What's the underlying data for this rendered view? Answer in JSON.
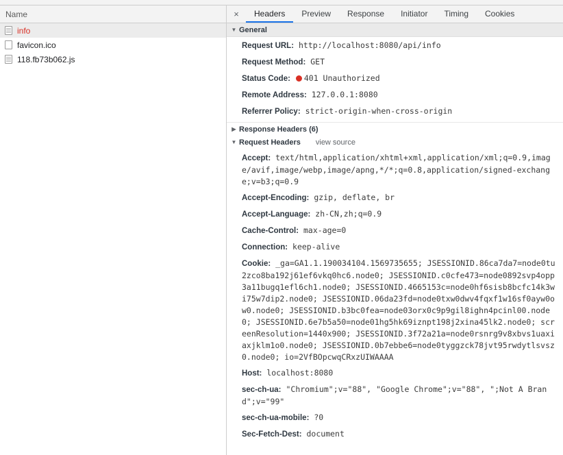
{
  "request_list": {
    "column_header": "Name",
    "rows": [
      {
        "label": "info",
        "icon": "document-icon",
        "selected": true,
        "error": true
      },
      {
        "label": "favicon.ico",
        "icon": "blank-file-icon",
        "selected": false,
        "error": false
      },
      {
        "label": "118.fb73b062.js",
        "icon": "script-icon",
        "selected": false,
        "error": false
      }
    ]
  },
  "details": {
    "close_label": "×",
    "tabs": [
      {
        "label": "Headers",
        "active": true
      },
      {
        "label": "Preview",
        "active": false
      },
      {
        "label": "Response",
        "active": false
      },
      {
        "label": "Initiator",
        "active": false
      },
      {
        "label": "Timing",
        "active": false
      },
      {
        "label": "Cookies",
        "active": false
      }
    ],
    "sections": {
      "general": {
        "title": "General",
        "triangle": "▼",
        "expanded": true,
        "rows": [
          {
            "key": "Request URL:",
            "value": "http://localhost:8080/api/info"
          },
          {
            "key": "Request Method:",
            "value": "GET"
          },
          {
            "key": "Status Code:",
            "value": "401 Unauthorized",
            "status_dot": true
          },
          {
            "key": "Remote Address:",
            "value": "127.0.0.1:8080"
          },
          {
            "key": "Referrer Policy:",
            "value": "strict-origin-when-cross-origin"
          }
        ]
      },
      "response_headers": {
        "title": "Response Headers (6)",
        "triangle": "▶",
        "expanded": false
      },
      "request_headers": {
        "title": "Request Headers",
        "triangle": "▼",
        "view_source": "view source",
        "expanded": true,
        "rows": [
          {
            "key": "Accept:",
            "value": "text/html,application/xhtml+xml,application/xml;q=0.9,image/avif,image/webp,image/apng,*/*;q=0.8,application/signed-exchange;v=b3;q=0.9"
          },
          {
            "key": "Accept-Encoding:",
            "value": "gzip, deflate, br"
          },
          {
            "key": "Accept-Language:",
            "value": "zh-CN,zh;q=0.9"
          },
          {
            "key": "Cache-Control:",
            "value": "max-age=0"
          },
          {
            "key": "Connection:",
            "value": "keep-alive"
          },
          {
            "key": "Cookie:",
            "value": "_ga=GA1.1.190034104.1569735655; JSESSIONID.86ca7da7=node0tu2zco8ba192j61ef6vkq0hc6.node0; JSESSIONID.c0cfe473=node0892svp4opp3a11bugq1efl6ch1.node0; JSESSIONID.4665153c=node0hf6sisb8bcfc14k3wi75w7dip2.node0; JSESSIONID.06da23fd=node0txw0dwv4fqxf1w16sf0ayw0ow0.node0; JSESSIONID.b3bc0fea=node03orx0c9p9gil8ighn4pcinl00.node0; JSESSIONID.6e7b5a50=node01hg5hk69iznpt198j2xina45lk2.node0; screenResolution=1440x900; JSESSIONID.3f72a21a=node0rsnrg9v8xbvs1uaxiaxjklm1o0.node0; JSESSIONID.0b7ebbe6=node0tyggzck78jvt95rwdytlsvsz0.node0; io=2VfBOpcwqCRxzUIWAAAA"
          },
          {
            "key": "Host:",
            "value": "localhost:8080"
          },
          {
            "key": "sec-ch-ua:",
            "value": "\"Chromium\";v=\"88\", \"Google Chrome\";v=\"88\", \";Not A Brand\";v=\"99\""
          },
          {
            "key": "sec-ch-ua-mobile:",
            "value": "?0"
          },
          {
            "key": "Sec-Fetch-Dest:",
            "value": "document"
          }
        ]
      }
    }
  },
  "colors": {
    "accent": "#1a73e8",
    "error": "#d93025",
    "header_bg": "#f3f3f3",
    "selected_row": "#ececec",
    "section_bg": "#eaeaea"
  }
}
